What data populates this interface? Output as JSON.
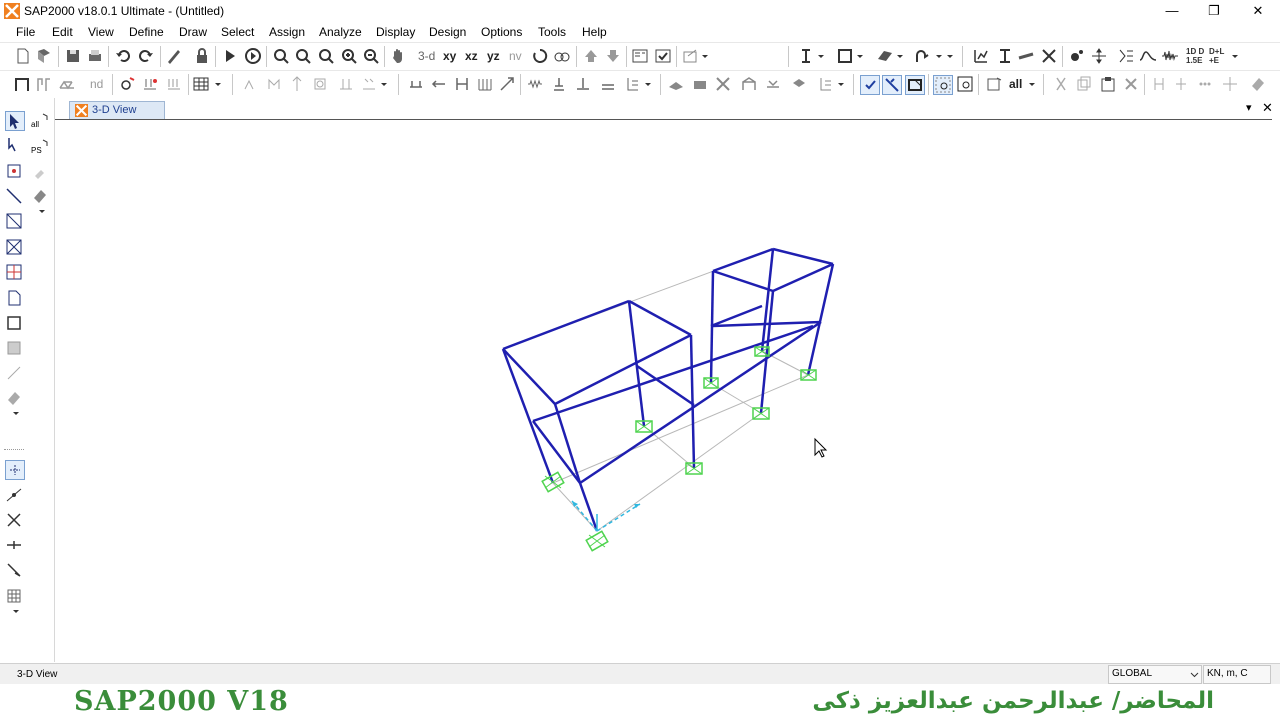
{
  "window": {
    "title": "SAP2000 v18.0.1 Ultimate  - (Untitled)",
    "minimize": "—",
    "restore": "❐",
    "close": "✕"
  },
  "menu": [
    "File",
    "Edit",
    "View",
    "Define",
    "Draw",
    "Select",
    "Assign",
    "Analyze",
    "Display",
    "Design",
    "Options",
    "Tools",
    "Help"
  ],
  "toolbar": {
    "view_3d": "3-d",
    "view_xy": "xy",
    "view_xz": "xz",
    "view_yz": "yz",
    "view_nv": "nv",
    "nd_label": "nd",
    "all_label": "all",
    "combo_label_top": "1D D",
    "combo_label_bottom": "1.5E",
    "dl_label_top": "D+L",
    "dl_label_bottom": "+E"
  },
  "left_toolbar": {
    "all_label": "all",
    "ps_label": "PS"
  },
  "tab": {
    "label": "3-D View"
  },
  "panel_controls": {
    "dropdown": "▾",
    "close": "✕"
  },
  "status": {
    "left": "3-D View",
    "coord_system": "GLOBAL",
    "units": "KN, m, C"
  },
  "footer": {
    "left": "SAP2000 V18",
    "right": "المحاضر/ عبدالرحمن عبدالعزيز ذكى"
  },
  "colors": {
    "frame": "#1f1fb0",
    "support": "#4fd44f",
    "grid": "#b8b8b8",
    "axis": "#30b8e0",
    "footer_text": "#3a8d3a"
  }
}
